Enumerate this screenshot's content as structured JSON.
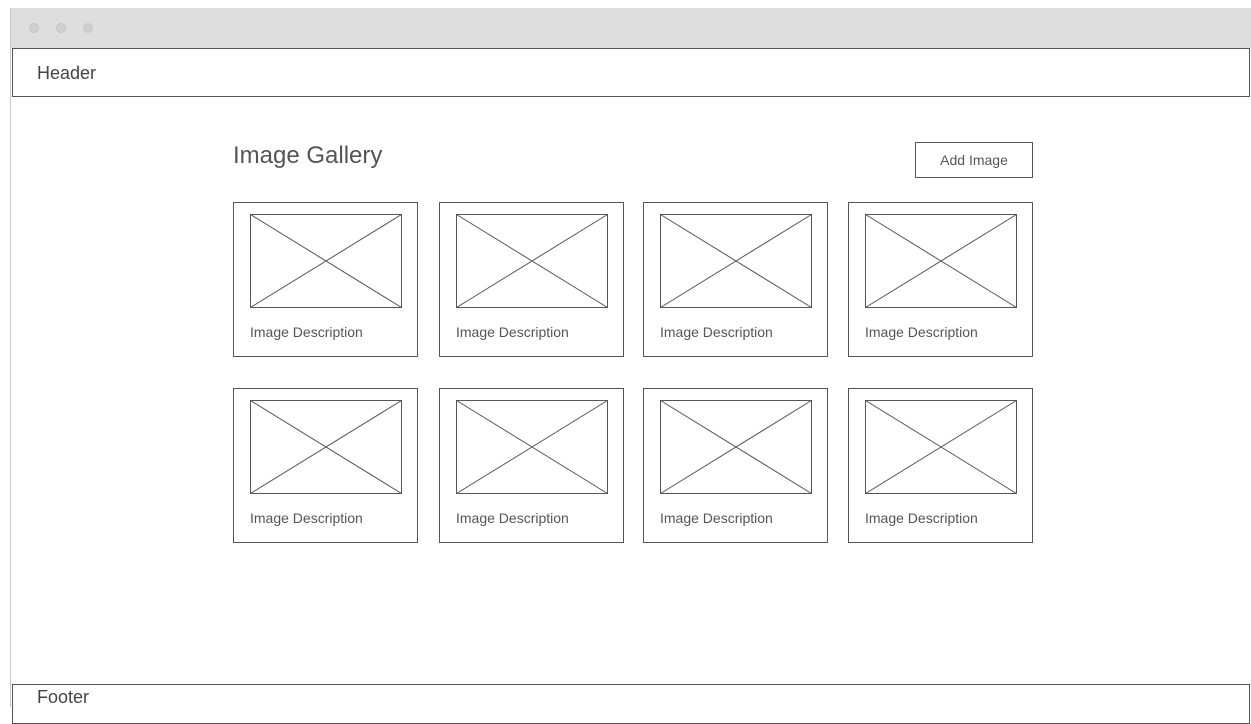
{
  "window": {
    "header_label": "Header",
    "footer_label": "Footer"
  },
  "gallery": {
    "title": "Image Gallery",
    "add_button_label": "Add Image",
    "items": [
      {
        "description": "Image Description"
      },
      {
        "description": "Image Description"
      },
      {
        "description": "Image Description"
      },
      {
        "description": "Image Description"
      },
      {
        "description": "Image Description"
      },
      {
        "description": "Image Description"
      },
      {
        "description": "Image Description"
      },
      {
        "description": "Image Description"
      }
    ]
  }
}
